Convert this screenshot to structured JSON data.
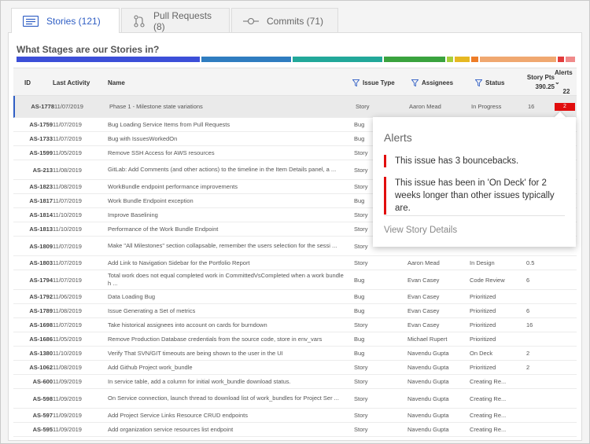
{
  "tabs": [
    {
      "label": "Stories (121)",
      "icon": "list-icon",
      "active": true
    },
    {
      "label": "Pull Requests (8)",
      "icon": "pull-request-icon",
      "active": false
    },
    {
      "label": "Commits (71)",
      "icon": "commit-icon",
      "active": false
    }
  ],
  "section_title": "What Stages are our Stories in?",
  "stage_colors": [
    "#3c4fd8",
    "#2f7dc0",
    "#22a89a",
    "#3aa33e",
    "#a8cf3c",
    "#e6b822",
    "#ee7d28",
    "#f0a870",
    "#e23b3b",
    "#f08a8a"
  ],
  "table": {
    "headers": {
      "id": "ID",
      "last_activity": "Last Activity",
      "name": "Name",
      "issue_type": "Issue Type",
      "assignees": "Assignees",
      "status": "Status",
      "story_pts": "Story Pts",
      "story_pts_total": "390.25",
      "alerts": "Alerts",
      "alerts_total": "22"
    },
    "rows": [
      {
        "id": "AS-1778",
        "date": "11/07/2019",
        "name": "Phase 1 - Milestone state variations",
        "type": "Story",
        "assignee": "Aaron Mead",
        "status": "In Progress",
        "pts": "16",
        "alerts": "2"
      },
      {
        "id": "AS-1759",
        "date": "11/07/2019",
        "name": "Bug Loading Service Items from Pull Requests",
        "type": "Bug",
        "assignee": "",
        "status": "",
        "pts": "",
        "alerts": ""
      },
      {
        "id": "AS-1733",
        "date": "11/07/2019",
        "name": "Bug with IssuesWorkedOn",
        "type": "Bug",
        "assignee": "",
        "status": "",
        "pts": "",
        "alerts": ""
      },
      {
        "id": "AS-1599",
        "date": "11/05/2019",
        "name": "Remove SSH Access for AWS resources",
        "type": "Story",
        "assignee": "",
        "status": "",
        "pts": "",
        "alerts": ""
      },
      {
        "id": "AS-213",
        "date": "11/08/2019",
        "name": "GitLab: Add Comments (and other actions) to the timeline in the Item Details panel, a ...",
        "type": "Story",
        "assignee": "",
        "status": "",
        "pts": "",
        "alerts": ""
      },
      {
        "id": "AS-1823",
        "date": "11/08/2019",
        "name": "WorkBundle endpoint performance improvements",
        "type": "Story",
        "assignee": "",
        "status": "",
        "pts": "",
        "alerts": ""
      },
      {
        "id": "AS-1817",
        "date": "11/07/2019",
        "name": "Work Bundle Endpoint exception",
        "type": "Bug",
        "assignee": "",
        "status": "",
        "pts": "",
        "alerts": ""
      },
      {
        "id": "AS-1814",
        "date": "11/10/2019",
        "name": "Improve Baselining",
        "type": "Story",
        "assignee": "",
        "status": "",
        "pts": "",
        "alerts": ""
      },
      {
        "id": "AS-1813",
        "date": "11/10/2019",
        "name": "Performance of the Work Bundle Endpoint",
        "type": "Story",
        "assignee": "",
        "status": "",
        "pts": "",
        "alerts": ""
      },
      {
        "id": "AS-1809",
        "date": "11/07/2019",
        "name": "Make \"All Milestones\" section collapsable, remember the users selection for the sessi ...",
        "type": "Story",
        "assignee": "",
        "status": "",
        "pts": "",
        "alerts": ""
      },
      {
        "id": "AS-1803",
        "date": "11/07/2019",
        "name": "Add Link to Navigation Sidebar for the Portfolio Report",
        "type": "Story",
        "assignee": "Aaron Mead",
        "status": "In Design",
        "pts": "0.5",
        "alerts": ""
      },
      {
        "id": "AS-1794",
        "date": "11/07/2019",
        "name": "Total work does not equal completed work in CommittedVsCompleted when a work bundle h ...",
        "type": "Bug",
        "assignee": "Evan Casey",
        "status": "Code Review",
        "pts": "6",
        "alerts": ""
      },
      {
        "id": "AS-1792",
        "date": "11/06/2019",
        "name": "Data Loading Bug",
        "type": "Bug",
        "assignee": "Evan Casey",
        "status": "Prioritized",
        "pts": "",
        "alerts": ""
      },
      {
        "id": "AS-1789",
        "date": "11/08/2019",
        "name": "Issue Generating a Set of metrics",
        "type": "Bug",
        "assignee": "Evan Casey",
        "status": "Prioritized",
        "pts": "6",
        "alerts": ""
      },
      {
        "id": "AS-1698",
        "date": "11/07/2019",
        "name": "Take historical assignees into account on cards for burndown",
        "type": "Story",
        "assignee": "Evan Casey",
        "status": "Prioritized",
        "pts": "16",
        "alerts": ""
      },
      {
        "id": "AS-1686",
        "date": "11/05/2019",
        "name": "Remove Production Database credentials from the source code, store in env_vars",
        "type": "Bug",
        "assignee": "Michael Rupert",
        "status": "Prioritized",
        "pts": "",
        "alerts": ""
      },
      {
        "id": "AS-1380",
        "date": "11/10/2019",
        "name": "Verify That SVN/GIT timeouts are being shown to the user in the UI",
        "type": "Bug",
        "assignee": "Navendu Gupta",
        "status": "On Deck",
        "pts": "2",
        "alerts": ""
      },
      {
        "id": "AS-1062",
        "date": "11/08/2019",
        "name": "Add Github Project work_bundle",
        "type": "Story",
        "assignee": "Navendu Gupta",
        "status": "Prioritized",
        "pts": "2",
        "alerts": ""
      },
      {
        "id": "AS-600",
        "date": "11/09/2019",
        "name": "In service table, add a column for initial work_bundle download status.",
        "type": "Story",
        "assignee": "Navendu Gupta",
        "status": "Creating Re...",
        "pts": "",
        "alerts": ""
      },
      {
        "id": "AS-598",
        "date": "11/09/2019",
        "name": "On Service connection, launch thread to download list of work_bundles for Project Ser ...",
        "type": "Story",
        "assignee": "Navendu Gupta",
        "status": "Creating Re...",
        "pts": "",
        "alerts": ""
      },
      {
        "id": "AS-597",
        "date": "11/09/2019",
        "name": "Add Project Service Links Resource CRUD endpoints",
        "type": "Story",
        "assignee": "Navendu Gupta",
        "status": "Creating Re...",
        "pts": "",
        "alerts": ""
      },
      {
        "id": "AS-595",
        "date": "11/09/2019",
        "name": "Add organization service resources list endpoint",
        "type": "Story",
        "assignee": "Navendu Gupta",
        "status": "Creating Re...",
        "pts": "",
        "alerts": ""
      }
    ]
  },
  "alerts_popup": {
    "title": "Alerts",
    "items": [
      "This issue has 3 bouncebacks.",
      "This issue has been in 'On Deck' for 2 weeks longer than other issues typically are."
    ],
    "link": "View Story Details"
  }
}
